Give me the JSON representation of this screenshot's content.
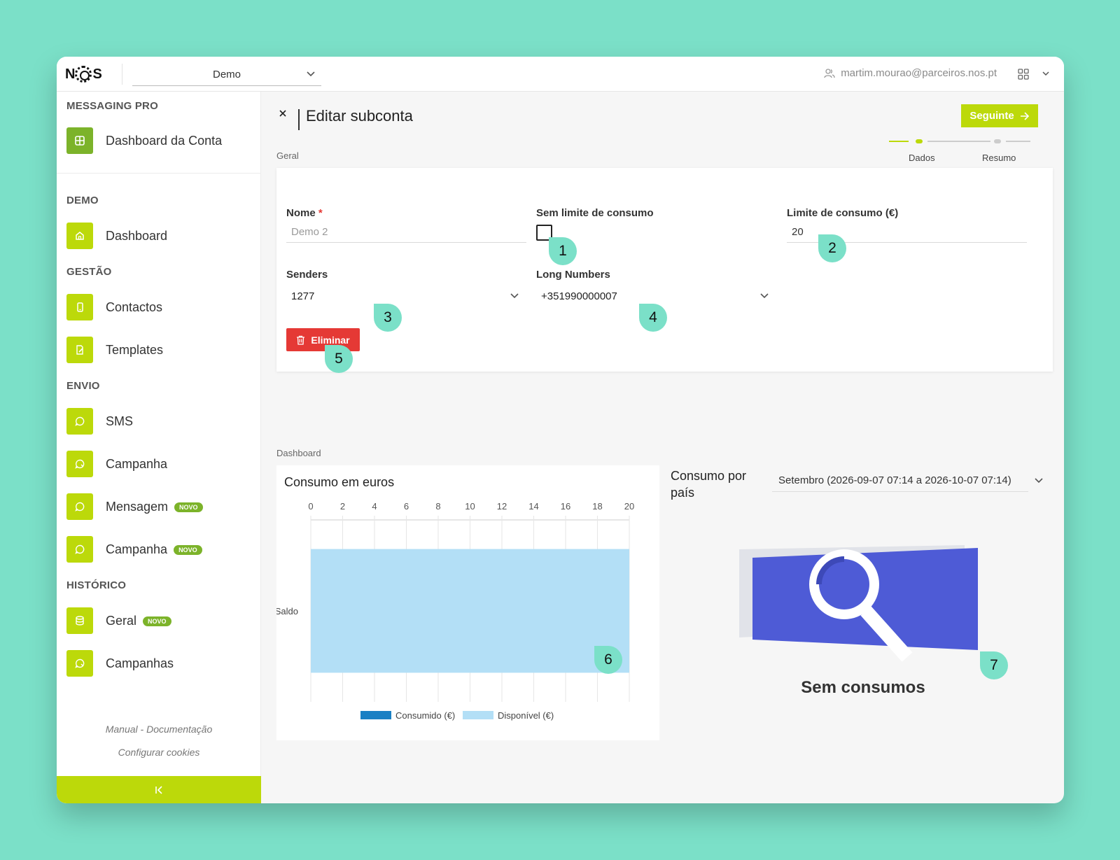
{
  "topbar": {
    "account": "Demo",
    "user_email": "martim.mourao@parceiros.nos.pt"
  },
  "sidebar": {
    "messaging_pro": {
      "title": "MESSAGING PRO",
      "items": [
        {
          "label": "Dashboard da Conta",
          "icon": "grid-icon"
        }
      ]
    },
    "demo": {
      "title": "DEMO",
      "items": [
        {
          "label": "Dashboard",
          "icon": "home-icon"
        }
      ]
    },
    "gestao": {
      "title": "GESTÃO",
      "items": [
        {
          "label": "Contactos",
          "icon": "phone-icon"
        },
        {
          "label": "Templates",
          "icon": "edit-icon"
        }
      ]
    },
    "envio": {
      "title": "ENVIO",
      "items": [
        {
          "label": "SMS",
          "icon": "chat-icon"
        },
        {
          "label": "Campanha",
          "icon": "chat-icon"
        },
        {
          "label": "Mensagem",
          "icon": "chat-icon",
          "badge": "NOVO"
        },
        {
          "label": "Campanha",
          "icon": "chat-icon",
          "badge": "NOVO"
        }
      ]
    },
    "historico": {
      "title": "HISTÓRICO",
      "items": [
        {
          "label": "Geral",
          "icon": "database-icon",
          "badge": "NOVO"
        },
        {
          "label": "Campanhas",
          "icon": "chat-icon"
        }
      ]
    },
    "footer": {
      "manual": "Manual - Documentação",
      "cookies": "Configurar cookies"
    }
  },
  "page": {
    "title": "Editar subconta",
    "next_button": "Seguinte",
    "steps": [
      "Dados",
      "Resumo"
    ],
    "section_geral": "Geral",
    "section_dashboard": "Dashboard"
  },
  "form": {
    "nome_label": "Nome",
    "nome_required": "*",
    "nome_placeholder": "Demo 2",
    "sem_limite_label": "Sem limite de consumo",
    "sem_limite_checked": false,
    "limite_label": "Limite de consumo (€)",
    "limite_value": "20",
    "senders_label": "Senders",
    "senders_value": "1277",
    "long_numbers_label": "Long Numbers",
    "long_numbers_value": "+351990000007",
    "delete_button": "Eliminar"
  },
  "chart_data": {
    "type": "bar",
    "orientation": "horizontal",
    "stacked": true,
    "title": "Consumo em euros",
    "categories": [
      "Saldo"
    ],
    "series": [
      {
        "name": "Consumido (€)",
        "values": [
          0
        ],
        "color": "#1a80c4"
      },
      {
        "name": "Disponível (€)",
        "values": [
          20
        ],
        "color": "#b3dff6"
      }
    ],
    "xticks": [
      0,
      2,
      4,
      6,
      8,
      10,
      12,
      14,
      16,
      18,
      20
    ],
    "xlim": [
      0,
      20
    ],
    "xaxis_position": "top",
    "legend_position": "bottom",
    "grid": true
  },
  "country": {
    "title": "Consumo por país",
    "period": "Setembro (2026-09-07 07:14 a 2026-10-07 07:14)",
    "empty_text": "Sem consumos"
  },
  "markers": [
    "1",
    "2",
    "3",
    "4",
    "5",
    "6",
    "7"
  ],
  "colors": {
    "accent": "#bcd90a",
    "accent_dark": "#7cb32a",
    "danger": "#e53935",
    "annotation": "#7be0c8"
  }
}
